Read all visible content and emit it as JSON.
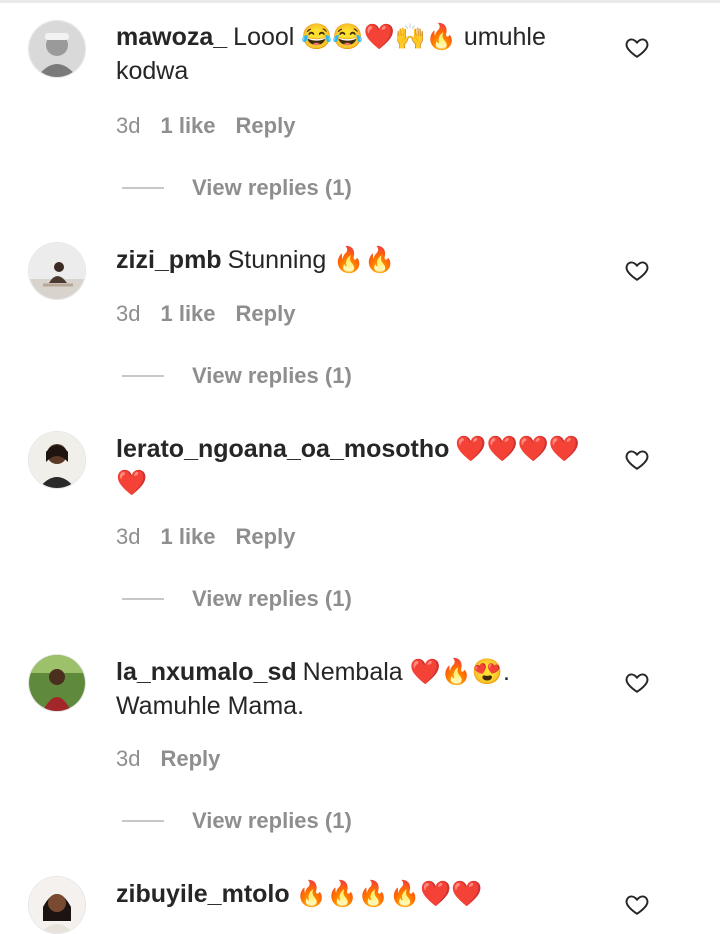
{
  "comments": [
    {
      "username": "mawoza_",
      "text": "Loool 😂😂❤️🙌🔥 umuhle kodwa",
      "time": "3d",
      "likes": "1 like",
      "reply_label": "Reply",
      "view_replies": "View replies (1)"
    },
    {
      "username": "zizi_pmb",
      "text": "Stunning 🔥🔥",
      "time": "3d",
      "likes": "1 like",
      "reply_label": "Reply",
      "view_replies": "View replies (1)"
    },
    {
      "username": "lerato_ngoana_oa_mosotho",
      "text": "❤️❤️❤️❤️❤️",
      "time": "3d",
      "likes": "1 like",
      "reply_label": "Reply",
      "view_replies": "View replies (1)"
    },
    {
      "username": "la_nxumalo_sd",
      "text": "Nembala ❤️🔥😍. Wamuhle Mama.",
      "time": "3d",
      "reply_label": "Reply",
      "view_replies": "View replies (1)"
    },
    {
      "username": "zibuyile_mtolo",
      "text": "🔥🔥🔥🔥❤️❤️"
    }
  ],
  "icons": {
    "like": "heart-outline-icon"
  },
  "colors": {
    "text": "#262626",
    "muted": "#8e8e8e",
    "background": "#ffffff"
  }
}
